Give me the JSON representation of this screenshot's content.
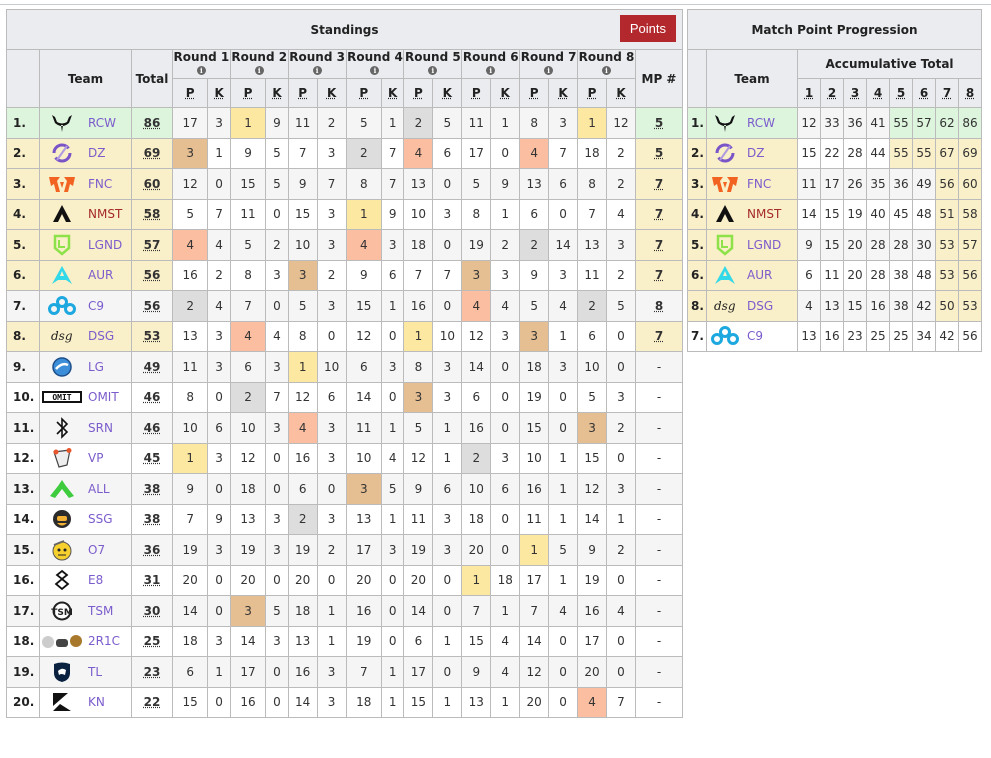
{
  "standings": {
    "title": "Standings",
    "points_button": "Points",
    "headers": {
      "team": "Team",
      "total": "Total",
      "mp": "MP #",
      "p": "P",
      "k": "K",
      "info": "i"
    },
    "rounds": [
      "Round 1",
      "Round 2",
      "Round 3",
      "Round 4",
      "Round 5",
      "Round 6",
      "Round 7",
      "Round 8"
    ],
    "colors": {
      "gold": "#fce8a1",
      "silver": "#dddddd",
      "bronze": "#e5be92",
      "fourth": "#fbbea0",
      "leader_row": "#ddf4dd",
      "match_point_row": "#f9efc8",
      "points_button": "#b3282d"
    },
    "rows": [
      {
        "rank": "1.",
        "team": "RCW",
        "icon": "rcw-logo-icon",
        "total": "86",
        "status": "first",
        "mp": "5",
        "rounds": [
          [
            17,
            3
          ],
          [
            1,
            9
          ],
          [
            11,
            2
          ],
          [
            5,
            1
          ],
          [
            2,
            5
          ],
          [
            11,
            1
          ],
          [
            8,
            3
          ],
          [
            1,
            12
          ]
        ]
      },
      {
        "rank": "2.",
        "team": "DZ",
        "icon": "dz-logo-icon",
        "total": "69",
        "status": "mp",
        "mp": "5",
        "rounds": [
          [
            3,
            1
          ],
          [
            9,
            5
          ],
          [
            7,
            3
          ],
          [
            2,
            7
          ],
          [
            4,
            6
          ],
          [
            17,
            0
          ],
          [
            4,
            7
          ],
          [
            18,
            2
          ]
        ]
      },
      {
        "rank": "3.",
        "team": "FNC",
        "icon": "fnc-logo-icon",
        "total": "60",
        "status": "mp",
        "mp": "7",
        "rounds": [
          [
            12,
            0
          ],
          [
            15,
            5
          ],
          [
            9,
            7
          ],
          [
            8,
            7
          ],
          [
            13,
            0
          ],
          [
            5,
            9
          ],
          [
            13,
            6
          ],
          [
            8,
            2
          ]
        ]
      },
      {
        "rank": "4.",
        "team": "NMST",
        "icon": "nmst-logo-icon",
        "total": "58",
        "status": "mp",
        "mp": "7",
        "rounds": [
          [
            5,
            7
          ],
          [
            11,
            0
          ],
          [
            15,
            3
          ],
          [
            1,
            9
          ],
          [
            10,
            3
          ],
          [
            8,
            1
          ],
          [
            6,
            0
          ],
          [
            7,
            4
          ]
        ]
      },
      {
        "rank": "5.",
        "team": "LGND",
        "icon": "lgnd-logo-icon",
        "total": "57",
        "status": "mp",
        "mp": "7",
        "rounds": [
          [
            4,
            4
          ],
          [
            5,
            2
          ],
          [
            10,
            3
          ],
          [
            4,
            3
          ],
          [
            18,
            0
          ],
          [
            19,
            2
          ],
          [
            2,
            14
          ],
          [
            13,
            3
          ]
        ]
      },
      {
        "rank": "6.",
        "team": "AUR",
        "icon": "aur-logo-icon",
        "total": "56",
        "status": "mp",
        "mp": "7",
        "rounds": [
          [
            16,
            2
          ],
          [
            8,
            3
          ],
          [
            3,
            2
          ],
          [
            9,
            6
          ],
          [
            7,
            7
          ],
          [
            3,
            3
          ],
          [
            9,
            3
          ],
          [
            11,
            2
          ]
        ]
      },
      {
        "rank": "7.",
        "team": "C9",
        "icon": "c9-logo-icon",
        "total": "56",
        "status": "",
        "mp": "8",
        "rounds": [
          [
            2,
            4
          ],
          [
            7,
            0
          ],
          [
            5,
            3
          ],
          [
            15,
            1
          ],
          [
            16,
            0
          ],
          [
            4,
            4
          ],
          [
            5,
            4
          ],
          [
            2,
            5
          ]
        ]
      },
      {
        "rank": "8.",
        "team": "DSG",
        "icon": "dsg-logo-icon",
        "total": "53",
        "status": "mp",
        "mp": "7",
        "rounds": [
          [
            13,
            3
          ],
          [
            4,
            4
          ],
          [
            8,
            0
          ],
          [
            12,
            0
          ],
          [
            1,
            10
          ],
          [
            12,
            3
          ],
          [
            3,
            1
          ],
          [
            6,
            0
          ]
        ]
      },
      {
        "rank": "9.",
        "team": "LG",
        "icon": "lg-logo-icon",
        "total": "49",
        "status": "",
        "mp": "-",
        "rounds": [
          [
            11,
            3
          ],
          [
            6,
            3
          ],
          [
            1,
            10
          ],
          [
            6,
            3
          ],
          [
            8,
            3
          ],
          [
            14,
            0
          ],
          [
            18,
            3
          ],
          [
            10,
            0
          ]
        ]
      },
      {
        "rank": "10.",
        "team": "OMIT",
        "icon": "omit-logo-icon",
        "total": "46",
        "status": "",
        "mp": "-",
        "rounds": [
          [
            8,
            0
          ],
          [
            2,
            7
          ],
          [
            12,
            6
          ],
          [
            14,
            0
          ],
          [
            3,
            3
          ],
          [
            6,
            0
          ],
          [
            19,
            0
          ],
          [
            5,
            3
          ]
        ]
      },
      {
        "rank": "11.",
        "team": "SRN",
        "icon": "srn-logo-icon",
        "total": "46",
        "status": "",
        "mp": "-",
        "rounds": [
          [
            10,
            6
          ],
          [
            10,
            3
          ],
          [
            4,
            3
          ],
          [
            11,
            1
          ],
          [
            5,
            1
          ],
          [
            16,
            0
          ],
          [
            15,
            0
          ],
          [
            3,
            2
          ]
        ]
      },
      {
        "rank": "12.",
        "team": "VP",
        "icon": "vp-logo-icon",
        "total": "45",
        "status": "",
        "mp": "-",
        "rounds": [
          [
            1,
            3
          ],
          [
            12,
            0
          ],
          [
            16,
            3
          ],
          [
            10,
            4
          ],
          [
            12,
            1
          ],
          [
            2,
            3
          ],
          [
            10,
            1
          ],
          [
            15,
            0
          ]
        ]
      },
      {
        "rank": "13.",
        "team": "ALL",
        "icon": "all-logo-icon",
        "total": "38",
        "status": "",
        "mp": "-",
        "rounds": [
          [
            9,
            0
          ],
          [
            18,
            0
          ],
          [
            6,
            0
          ],
          [
            3,
            5
          ],
          [
            9,
            6
          ],
          [
            10,
            6
          ],
          [
            16,
            1
          ],
          [
            12,
            3
          ]
        ]
      },
      {
        "rank": "14.",
        "team": "SSG",
        "icon": "ssg-logo-icon",
        "total": "38",
        "status": "",
        "mp": "-",
        "rounds": [
          [
            7,
            9
          ],
          [
            13,
            3
          ],
          [
            2,
            3
          ],
          [
            13,
            1
          ],
          [
            11,
            3
          ],
          [
            18,
            0
          ],
          [
            11,
            1
          ],
          [
            14,
            1
          ]
        ]
      },
      {
        "rank": "15.",
        "team": "O7",
        "icon": "o7-logo-icon",
        "total": "36",
        "status": "",
        "mp": "-",
        "rounds": [
          [
            19,
            3
          ],
          [
            19,
            3
          ],
          [
            19,
            2
          ],
          [
            17,
            3
          ],
          [
            19,
            3
          ],
          [
            20,
            0
          ],
          [
            1,
            5
          ],
          [
            9,
            2
          ]
        ]
      },
      {
        "rank": "16.",
        "team": "E8",
        "icon": "e8-logo-icon",
        "total": "31",
        "status": "",
        "mp": "-",
        "rounds": [
          [
            20,
            0
          ],
          [
            20,
            0
          ],
          [
            20,
            0
          ],
          [
            20,
            0
          ],
          [
            20,
            0
          ],
          [
            1,
            18
          ],
          [
            17,
            1
          ],
          [
            19,
            0
          ]
        ]
      },
      {
        "rank": "17.",
        "team": "TSM",
        "icon": "tsm-logo-icon",
        "total": "30",
        "status": "",
        "mp": "-",
        "rounds": [
          [
            14,
            0
          ],
          [
            3,
            5
          ],
          [
            18,
            1
          ],
          [
            16,
            0
          ],
          [
            14,
            0
          ],
          [
            7,
            1
          ],
          [
            7,
            4
          ],
          [
            16,
            4
          ]
        ]
      },
      {
        "rank": "18.",
        "team": "2R1C",
        "icon": "2r1c-logo-icon",
        "total": "25",
        "status": "",
        "mp": "-",
        "rounds": [
          [
            18,
            3
          ],
          [
            14,
            3
          ],
          [
            13,
            1
          ],
          [
            19,
            0
          ],
          [
            6,
            1
          ],
          [
            15,
            4
          ],
          [
            14,
            0
          ],
          [
            17,
            0
          ]
        ]
      },
      {
        "rank": "19.",
        "team": "TL",
        "icon": "tl-logo-icon",
        "total": "23",
        "status": "",
        "mp": "-",
        "rounds": [
          [
            6,
            1
          ],
          [
            17,
            0
          ],
          [
            16,
            3
          ],
          [
            7,
            1
          ],
          [
            17,
            0
          ],
          [
            9,
            4
          ],
          [
            12,
            0
          ],
          [
            20,
            0
          ]
        ]
      },
      {
        "rank": "20.",
        "team": "KN",
        "icon": "kn-logo-icon",
        "total": "22",
        "status": "",
        "mp": "-",
        "rounds": [
          [
            15,
            0
          ],
          [
            16,
            0
          ],
          [
            14,
            3
          ],
          [
            18,
            1
          ],
          [
            15,
            1
          ],
          [
            13,
            1
          ],
          [
            20,
            0
          ],
          [
            4,
            7
          ]
        ]
      }
    ]
  },
  "progression": {
    "title": "Match Point Progression",
    "team_header": "Team",
    "group_header": "Accumulative Total",
    "rounds": [
      "1",
      "2",
      "3",
      "4",
      "5",
      "6",
      "7",
      "8"
    ],
    "match_point_threshold": 50,
    "rows": [
      {
        "rank": "1.",
        "team": "RCW",
        "icon": "rcw-logo-icon",
        "status": "first",
        "totals": [
          12,
          33,
          36,
          41,
          55,
          57,
          62,
          86
        ]
      },
      {
        "rank": "2.",
        "team": "DZ",
        "icon": "dz-logo-icon",
        "status": "mp",
        "totals": [
          15,
          22,
          28,
          44,
          55,
          55,
          67,
          69
        ]
      },
      {
        "rank": "3.",
        "team": "FNC",
        "icon": "fnc-logo-icon",
        "status": "mp",
        "totals": [
          11,
          17,
          26,
          35,
          36,
          49,
          56,
          60
        ]
      },
      {
        "rank": "4.",
        "team": "NMST",
        "icon": "nmst-logo-icon",
        "status": "mp",
        "totals": [
          14,
          15,
          19,
          40,
          45,
          48,
          51,
          58
        ]
      },
      {
        "rank": "5.",
        "team": "LGND",
        "icon": "lgnd-logo-icon",
        "status": "mp",
        "totals": [
          9,
          15,
          20,
          28,
          28,
          30,
          53,
          57
        ]
      },
      {
        "rank": "6.",
        "team": "AUR",
        "icon": "aur-logo-icon",
        "status": "mp",
        "totals": [
          6,
          11,
          20,
          28,
          38,
          48,
          53,
          56
        ]
      },
      {
        "rank": "8.",
        "team": "DSG",
        "icon": "dsg-logo-icon",
        "status": "mp",
        "totals": [
          4,
          13,
          15,
          16,
          38,
          42,
          50,
          53
        ]
      },
      {
        "rank": "7.",
        "team": "C9",
        "icon": "c9-logo-icon",
        "status": "",
        "totals": [
          13,
          16,
          23,
          25,
          25,
          34,
          42,
          56
        ]
      }
    ]
  }
}
